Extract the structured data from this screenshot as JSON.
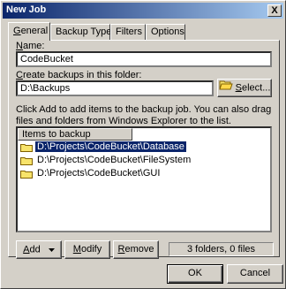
{
  "window": {
    "title": "New Job",
    "close_label": "X"
  },
  "tabs": [
    {
      "label": "General",
      "ul": "G",
      "rest": "eneral"
    },
    {
      "label": "Backup Type"
    },
    {
      "label": "Filters"
    },
    {
      "label": "Options"
    }
  ],
  "general": {
    "name_label_ul": "N",
    "name_label_rest": "ame:",
    "name_value": "CodeBucket",
    "folder_label_ul": "C",
    "folder_label_rest": "reate backups in this folder:",
    "folder_value": "D:\\Backups",
    "select_button_ul": "S",
    "select_button_rest": "elect...",
    "description": "Click Add to add items to the backup job.  You can also drag files and folders from Windows Explorer to the list.",
    "list_header": "Items to backup",
    "items": [
      "D:\\Projects\\CodeBucket\\Database",
      "D:\\Projects\\CodeBucket\\FileSystem",
      "D:\\Projects\\CodeBucket\\GUI"
    ],
    "selected_index": 0,
    "add_button_ul": "A",
    "add_button_rest": "dd",
    "modify_button_ul": "M",
    "modify_button_rest": "odify",
    "remove_button_ul": "R",
    "remove_button_rest": "emove",
    "status_text": "3 folders, 0 files"
  },
  "footer": {
    "ok_label": "OK",
    "cancel_label": "Cancel"
  },
  "colors": {
    "selection": "#0a246a",
    "title_start": "#0a246a",
    "title_end": "#a6caf0",
    "folder": "#f7e36b"
  }
}
